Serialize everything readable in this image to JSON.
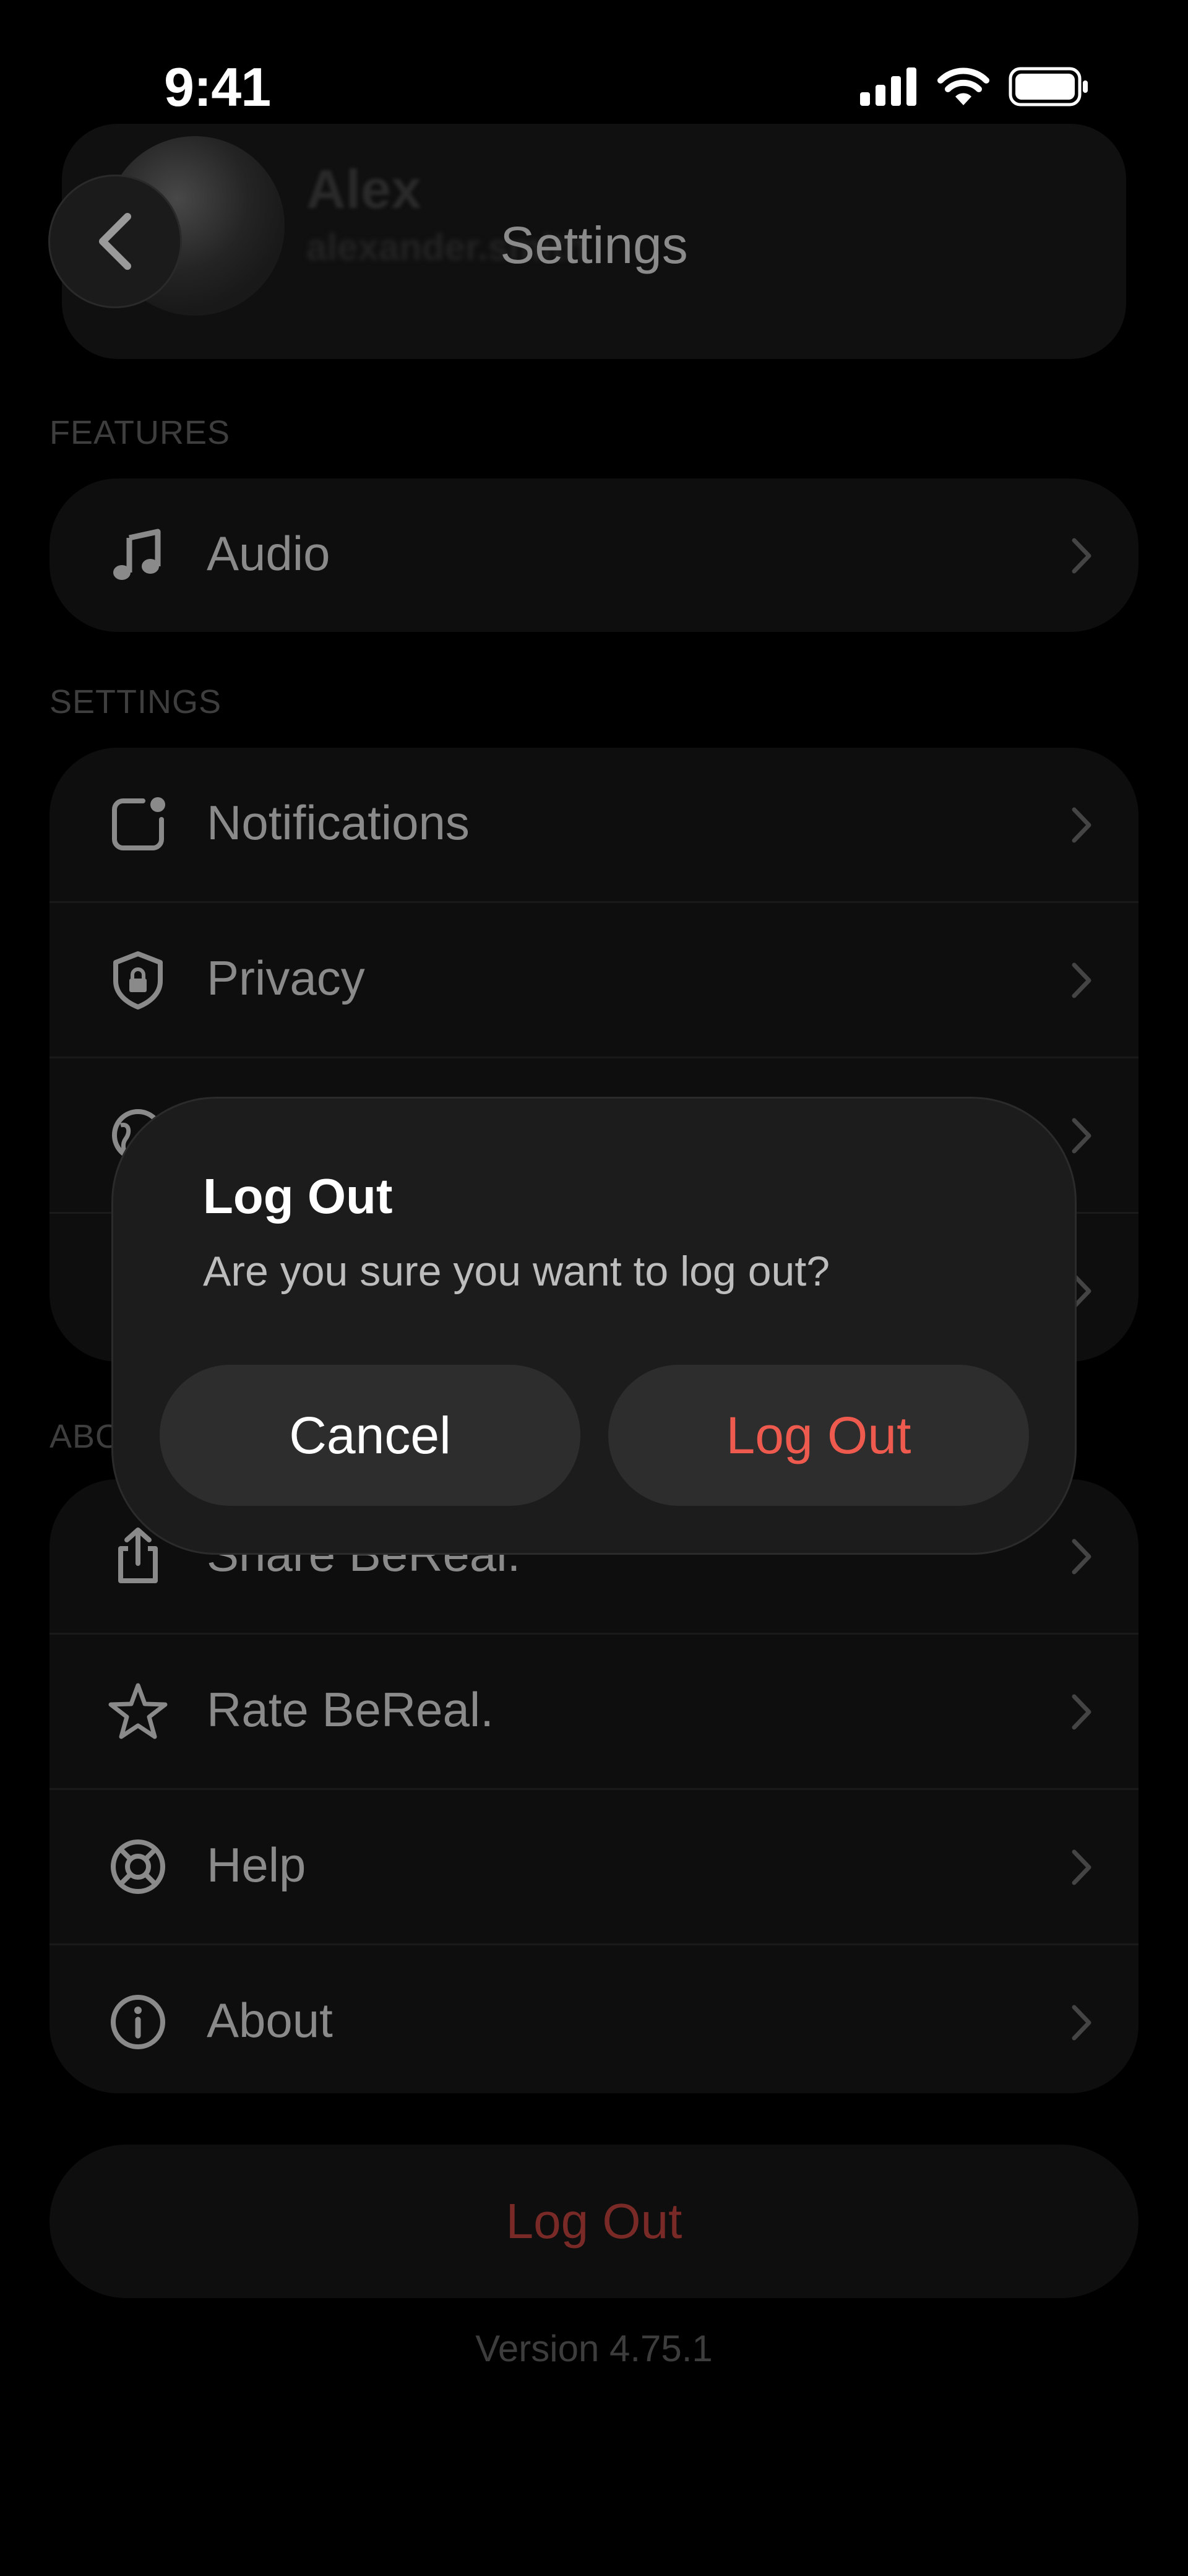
{
  "status_bar": {
    "time": "9:41"
  },
  "header": {
    "title": "Settings",
    "profile_name": "Alex",
    "profile_handle": "alexander.smith"
  },
  "sections": {
    "features": {
      "label": "FEATURES",
      "items": [
        {
          "label": "Audio",
          "icon": "music-note-icon"
        }
      ]
    },
    "settings": {
      "label": "SETTINGS",
      "items": [
        {
          "label": "Notifications",
          "icon": "notification-icon"
        },
        {
          "label": "Privacy",
          "icon": "shield-lock-icon"
        },
        {
          "label": "",
          "icon": "globe-icon"
        },
        {
          "label": "",
          "icon": "settings-icon"
        }
      ]
    },
    "about": {
      "label": "ABOUT",
      "items": [
        {
          "label": "Share BeReal.",
          "icon": "share-icon"
        },
        {
          "label": "Rate BeReal.",
          "icon": "star-icon"
        },
        {
          "label": "Help",
          "icon": "lifebuoy-icon"
        },
        {
          "label": "About",
          "icon": "info-icon"
        }
      ]
    }
  },
  "logout_button": {
    "label": "Log Out"
  },
  "version": "Version 4.75.1",
  "dialog": {
    "title": "Log Out",
    "message": "Are you sure you want to log out?",
    "cancel_label": "Cancel",
    "confirm_label": "Log Out"
  },
  "colors": {
    "background": "#000000",
    "dialog_background": "#1c1c1c",
    "destructive": "#ef5a4f"
  }
}
